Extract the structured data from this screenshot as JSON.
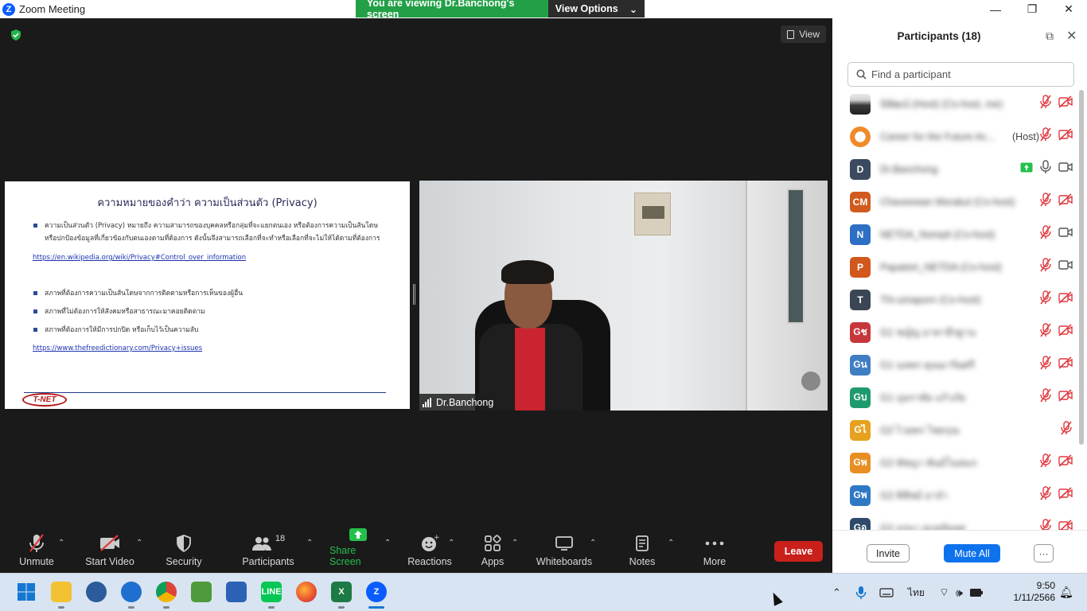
{
  "window": {
    "title": "Zoom Meeting",
    "banner_text": "You are viewing Dr.Banchong's screen",
    "view_options_label": "View Options"
  },
  "meeting": {
    "view_label": "View",
    "slide": {
      "title": "ความหมายของคำว่า ความเป็นส่วนตัว (Privacy)",
      "bullet1_line1": "ความเป็นส่วนตัว (Privacy)        หมายถึง ความสามารถของบุคคลหรือกลุ่มที่จะแยกตนเอง หรือต้องการความเป็นส้นโดษ",
      "bullet1_line2": "หรือปกป้องข้อมูลที่เกี่ยวข้องกับตนเองตามที่ต้องการ ดังนั้นจึงสามารถเลือกที่จะทำหรือเลือกที่จะไม่ให้ได้ตามที่ต้องการ",
      "link1": "https://en.wikipedia.org/wiki/Privacy#Control_over_information",
      "bullet2": "สภาพที่ต้องการความเป็นส้นโดษจากการติดตามหรือการเห็นของผู้อื่น",
      "bullet3": "สภาพที่ไม่ต้องการให้สังคมหรือสาธารณะมาคอยติดตาม",
      "bullet4": "สภาพที่ต้องการให้มีการปกปิด หรือเก็บไว้เป็นความลับ",
      "link2": "https://www.thefreedictionary.com/Privacy+issues",
      "logo_text": "T-NET"
    },
    "video_name": "Dr.Banchong"
  },
  "toolbar": {
    "unmute": "Unmute",
    "start_video": "Start Video",
    "security": "Security",
    "participants": "Participants",
    "participants_count": "18",
    "share_screen": "Share Screen",
    "reactions": "Reactions",
    "apps": "Apps",
    "whiteboards": "Whiteboards",
    "notes": "Notes",
    "more": "More",
    "leave": "Leave"
  },
  "panel": {
    "title": "Participants (18)",
    "search_placeholder": "Find a participant",
    "participants": [
      {
        "initials": "",
        "name": "นิพิฒน์ (Host) (Co-host, me)",
        "role": "",
        "color": "#7a7a7a",
        "photo": true,
        "mic": "muted",
        "video": "off"
      },
      {
        "initials": "",
        "name": "Career for the Future Ac...",
        "role": "(Host)",
        "color": "#f08a2a",
        "photo": false,
        "logo": true,
        "mic": "muted",
        "video": "off"
      },
      {
        "initials": "D",
        "name": "Dr.Banchong",
        "role": "",
        "color": "#3b4a5e",
        "mic": "on",
        "video": "on",
        "sharing": true
      },
      {
        "initials": "CM",
        "name": "Chaveewan Morakul (Co-host)",
        "role": "",
        "color": "#d15a1f",
        "mic": "muted",
        "video": "off"
      },
      {
        "initials": "N",
        "name": "NETDA_Nompit (Co-host)",
        "role": "",
        "color": "#2e6fc6",
        "mic": "muted",
        "video": "on"
      },
      {
        "initials": "P",
        "name": "Papatsiri_NETDA (Co-host)",
        "role": "",
        "color": "#d1571c",
        "mic": "muted",
        "video": "on"
      },
      {
        "initials": "T",
        "name": "Thi-umaporn (Co-host)",
        "role": "",
        "color": "#3b4654",
        "mic": "muted",
        "video": "off"
      },
      {
        "initials": "Gช",
        "name": "G1 ชญัญ อาทาธีรฐาน",
        "role": "",
        "color": "#c5373b",
        "mic": "muted",
        "video": "off"
      },
      {
        "initials": "Gน",
        "name": "G1 นลพร คุณมาริยศรี",
        "role": "",
        "color": "#3f7ec2",
        "mic": "muted",
        "video": "off"
      },
      {
        "initials": "Gบ",
        "name": "G1 บุษราทัย แก้วภัย",
        "role": "",
        "color": "#1f9a6d",
        "mic": "muted",
        "video": "off"
      },
      {
        "initials": "Gไ",
        "name": "G2 ไวยพร ไชยรุณ",
        "role": "",
        "color": "#e6a11f",
        "mic": "muted",
        "video": "none"
      },
      {
        "initials": "Gพ",
        "name": "G2 พัชญา พันธ์โนสมภ",
        "role": "",
        "color": "#e88f24",
        "mic": "muted",
        "video": "off"
      },
      {
        "initials": "Gพ",
        "name": "G2 พิชิชย์ อาจำ",
        "role": "",
        "color": "#2f78c4",
        "mic": "muted",
        "video": "off"
      },
      {
        "initials": "Gอ",
        "name": "G2 อรษา สุภสุลัยยศ",
        "role": "",
        "color": "#2f4a6a",
        "mic": "muted",
        "video": "off"
      }
    ],
    "invite": "Invite",
    "mute_all": "Mute All",
    "more": "···"
  },
  "taskbar": {
    "time": "9:50",
    "date": "1/11/2566",
    "lang": "ไทย"
  },
  "colors": {
    "green": "#23a047",
    "zoom_blue": "#0e72ed",
    "leave_red": "#c9201c",
    "muted_red": "#e0393e"
  }
}
